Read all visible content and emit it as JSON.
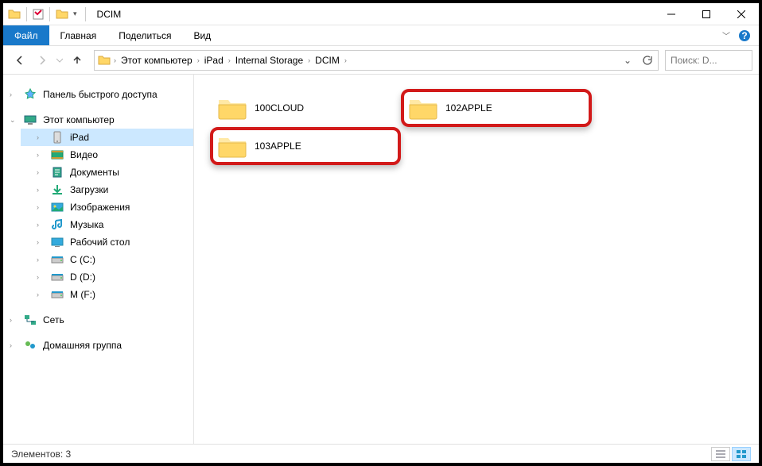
{
  "title": "DCIM",
  "ribbon": {
    "file": "Файл",
    "tabs": [
      "Главная",
      "Поделиться",
      "Вид"
    ]
  },
  "breadcrumb": [
    "Этот компьютер",
    "iPad",
    "Internal Storage",
    "DCIM"
  ],
  "search_placeholder": "Поиск: D...",
  "sidebar": {
    "quick": "Панель быстрого доступа",
    "pc": "Этот компьютер",
    "items": [
      {
        "label": "iPad",
        "icon": "device",
        "selected": true
      },
      {
        "label": "Видео",
        "icon": "video"
      },
      {
        "label": "Документы",
        "icon": "docs"
      },
      {
        "label": "Загрузки",
        "icon": "downloads"
      },
      {
        "label": "Изображения",
        "icon": "pictures"
      },
      {
        "label": "Музыка",
        "icon": "music"
      },
      {
        "label": "Рабочий стол",
        "icon": "desktop"
      },
      {
        "label": "C (C:)",
        "icon": "drive"
      },
      {
        "label": "D (D:)",
        "icon": "drive"
      },
      {
        "label": "M (F:)",
        "icon": "drive"
      }
    ],
    "network": "Сеть",
    "homegroup": "Домашняя группа"
  },
  "folders": [
    {
      "name": "100CLOUD",
      "highlight": false
    },
    {
      "name": "102APPLE",
      "highlight": true
    },
    {
      "name": "103APPLE",
      "highlight": true
    }
  ],
  "status": "Элементов: 3"
}
